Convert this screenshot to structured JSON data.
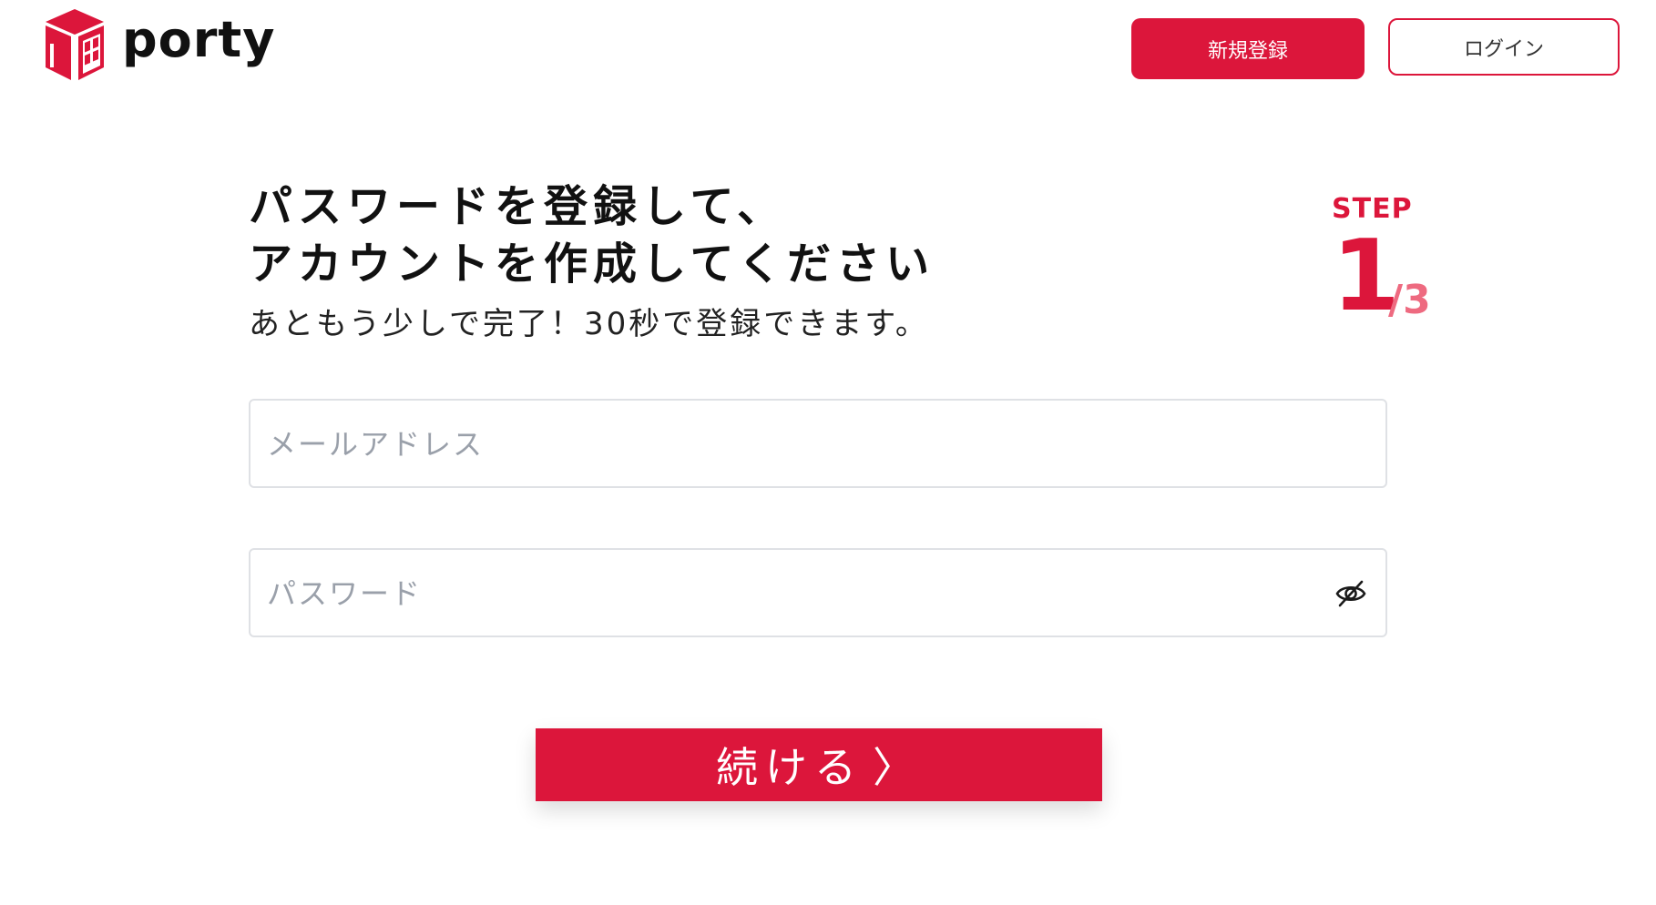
{
  "header": {
    "brand": "porty",
    "signup_label": "新規登録",
    "login_label": "ログイン"
  },
  "main": {
    "headline_line1": "パスワードを登録して、",
    "headline_line2": "アカウントを作成してください",
    "subline": "あともう少しで完了！30秒で登録できます。",
    "step": {
      "label": "STEP",
      "current": "1",
      "total": "/3"
    },
    "email_field": {
      "placeholder": "メールアドレス",
      "value": ""
    },
    "password_field": {
      "placeholder": "パスワード",
      "value": "",
      "toggle_icon": "eye-off-icon"
    },
    "continue_label": "続ける",
    "continue_icon": "〉"
  },
  "colors": {
    "accent": "#dc163b",
    "step_total": "#ee6a80",
    "field_border": "#dfe1e5",
    "placeholder": "#9aa0aa"
  }
}
